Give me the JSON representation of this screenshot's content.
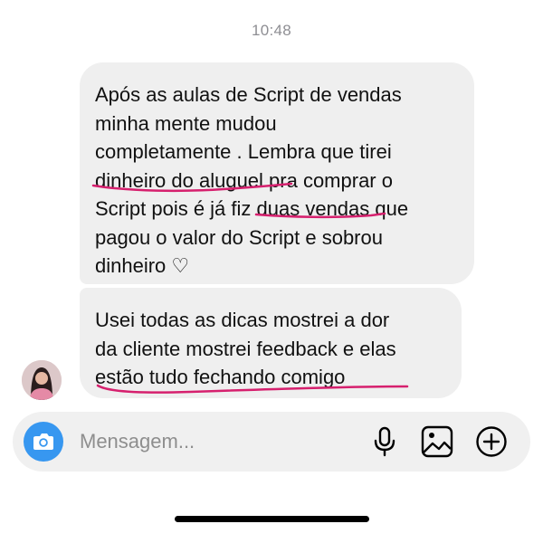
{
  "timestamp": "10:48",
  "messages": [
    {
      "lines": [
        "Após as aulas de Script de vendas",
        "minha mente mudou",
        "completamente  . Lembra que tirei",
        "dinheiro do aluguel pra comprar o",
        "Script pois é já fiz duas vendas que",
        "pagou o valor do Script e sobrou",
        "dinheiro ♡"
      ]
    },
    {
      "lines": [
        "Usei todas as dicas mostrei a dor",
        "da cliente mostrei feedback e elas",
        "estão tudo fechando comigo"
      ]
    }
  ],
  "composer": {
    "placeholder": "Mensagem...",
    "camera_icon": "camera-icon",
    "tools": [
      "microphone-icon",
      "gallery-icon",
      "add-icon"
    ]
  },
  "colors": {
    "bubble": "#efefef",
    "underline": "#d6206e",
    "accent": "#3797f0",
    "timestamp": "#8e8e93",
    "placeholder": "#8e8e8e"
  }
}
